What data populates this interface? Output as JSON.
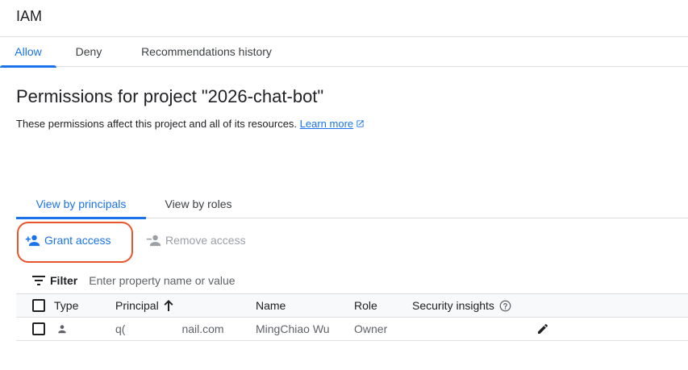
{
  "app": {
    "title": "IAM"
  },
  "main_tabs": [
    {
      "label": "Allow",
      "active": true
    },
    {
      "label": "Deny",
      "active": false
    },
    {
      "label": "Recommendations history",
      "active": false
    }
  ],
  "page": {
    "heading": "Permissions for project \"2026-chat-bot\"",
    "description": "These permissions affect this project and all of its resources.",
    "learn_more": "Learn more"
  },
  "view_tabs": [
    {
      "label": "View by principals",
      "active": true
    },
    {
      "label": "View by roles",
      "active": false
    }
  ],
  "actions": {
    "grant": "Grant access",
    "remove": "Remove access"
  },
  "filter": {
    "label": "Filter",
    "placeholder": "Enter property name or value"
  },
  "table": {
    "columns": [
      "Type",
      "Principal",
      "Name",
      "Role",
      "Security insights"
    ],
    "rows": [
      {
        "type_icon": "person-icon",
        "principal_start": "q(",
        "principal_end": "nail.com",
        "name": "MingChiao Wu",
        "role": "Owner"
      }
    ]
  },
  "icons": {
    "add_person": "person-add-icon",
    "remove_person": "person-remove-icon",
    "filter": "filter-icon",
    "sort": "arrow-up-icon",
    "help": "help-icon",
    "edit": "pencil-icon",
    "external": "external-link-icon"
  },
  "colors": {
    "accent": "#1a73e8",
    "highlight": "#e8542b",
    "disabled": "#9aa0a6"
  }
}
